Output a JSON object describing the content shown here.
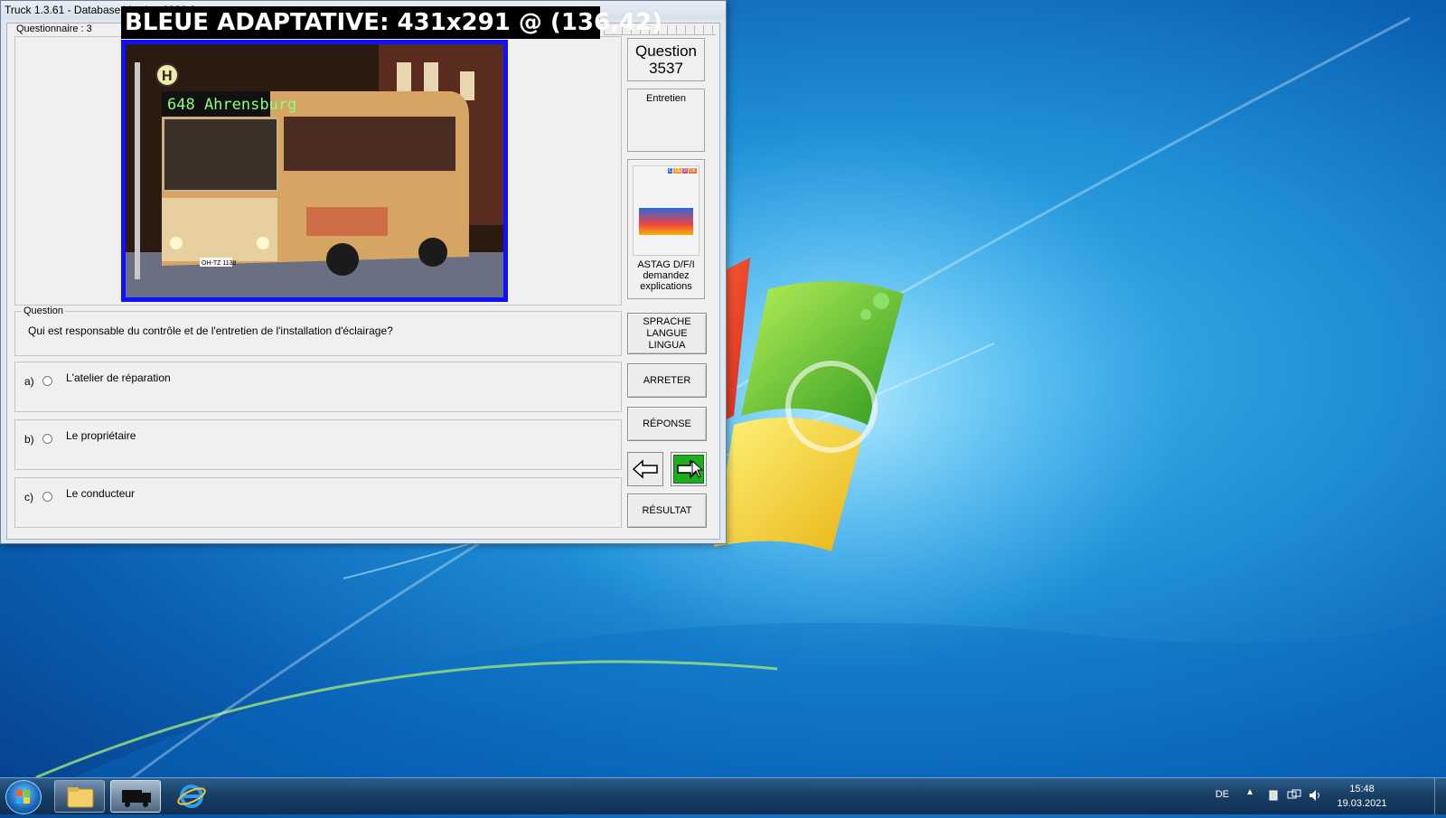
{
  "window": {
    "title": "Truck 1.3.61 - Database Version 2020.2",
    "overlay_caption": "BLEUE ADAPTATIVE: 431x291 @ (136,42)"
  },
  "questionnaire": {
    "label": "Questionnaire : 3"
  },
  "photo": {
    "description_icon": "city-bus-photo",
    "destination_sign": "648 Ahrensburg",
    "plate": "OH-TZ 1138"
  },
  "question_panel": {
    "number_label": "Question",
    "number": "3537",
    "category": "Entretien",
    "book_lines": [
      "ASTAG D/F/I",
      "demandez",
      "explications"
    ],
    "book_cover_badges": [
      "C",
      "CE",
      "D",
      "DE"
    ]
  },
  "question": {
    "group_label": "Question",
    "text": "Qui est responsable du contrôle et de l'entretien de l'installation d'éclairage?"
  },
  "answers": [
    {
      "letter": "a)",
      "text": "L'atelier de réparation"
    },
    {
      "letter": "b)",
      "text": "Le propriétaire"
    },
    {
      "letter": "c)",
      "text": "Le conducteur"
    }
  ],
  "buttons": {
    "language": [
      "SPRACHE",
      "LANGUE",
      "LINGUA"
    ],
    "stop": "ARRETER",
    "answer": "RÉPONSE",
    "result": "RÉSULTAT"
  },
  "taskbar": {
    "language": "DE",
    "time": "15:48",
    "date": "19.03.2021"
  },
  "colors": {
    "highlight_border": "#1010ff",
    "next_button": "#1fae1f"
  }
}
